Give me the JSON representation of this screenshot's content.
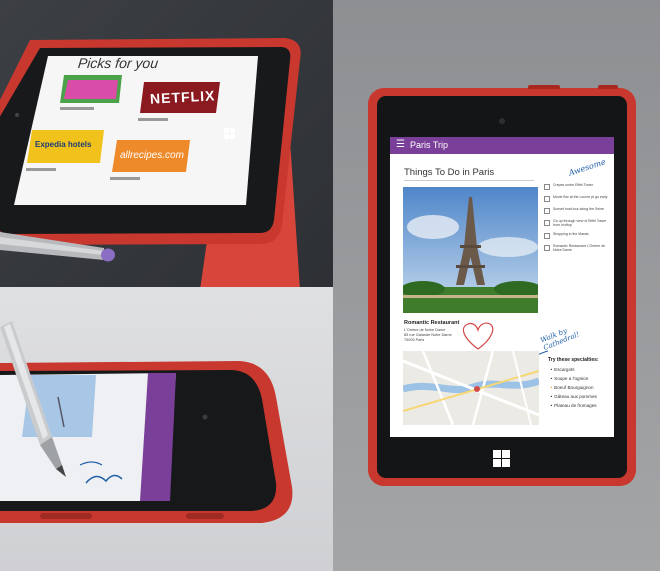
{
  "store": {
    "heading": "Picks for you",
    "tiles": [
      {
        "name": "Netflix",
        "brand": "NETFLIX"
      },
      {
        "name": "Expedia",
        "brand": "Expedia hotels"
      },
      {
        "name": "Allrecipes",
        "brand": "allrecipes.com"
      }
    ]
  },
  "onenote": {
    "header_title": "Paris Trip",
    "page_title": "Things To Do in Paris",
    "annotation_awesome": "Awesome",
    "annotation_walk": "Walk by Cathedral!",
    "checklist": [
      "Crepes under Eiffel Tower",
      "Movie Bar at the Louvre pt go early",
      "Sunset boat tour along the Seine",
      "Go up through view of Eiffel Tower from rooftop",
      "Shopping in the Marais",
      "Romantic Restaurant L'Ombre de Notre Dame"
    ],
    "restaurant_title": "Romantic Restaurant",
    "restaurant_lines": [
      "L'Ombre de Notre Dame",
      "85 rue Galande Notre Dame",
      "75005 Paris"
    ],
    "specialties_title": "Try these specialties:",
    "specialties": [
      "Escargots",
      "Soupe a l'ognion",
      "Boeuf Bourguignon",
      "Gâteau aux pommes",
      "Plateau de fromages"
    ]
  },
  "colors": {
    "case_red": "#c8382f",
    "onenote_purple": "#7a3f98",
    "pen_tip": "#8a6ec3",
    "ink_blue": "#1f5fa8"
  }
}
